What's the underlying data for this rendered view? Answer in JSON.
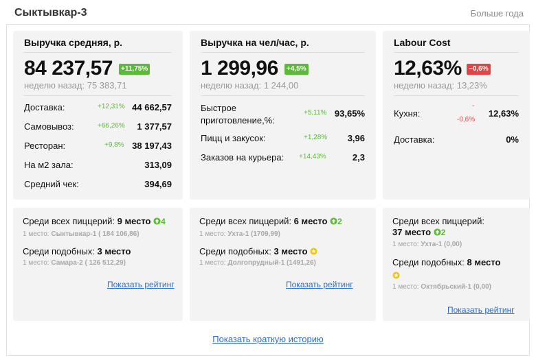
{
  "header": {
    "title": "Сыктывкар-3",
    "period": "Больше года"
  },
  "cards": [
    {
      "title": "Выручка средняя, р.",
      "value": "84 237,57",
      "delta": "+11,75%",
      "week_label": "неделю назад:",
      "week_value": "75 383,71",
      "rows": [
        {
          "label": "Доставка:",
          "pct": "+12,31%",
          "value": "44 662,57"
        },
        {
          "label": "Самовывоз:",
          "pct": "+66,26%",
          "value": "1 377,57"
        },
        {
          "label": "Ресторан:",
          "pct": "+9,8%",
          "value": "38 197,43"
        },
        {
          "label": "На м2 зала:",
          "pct": "",
          "value": "313,09"
        },
        {
          "label": "Средний чек:",
          "pct": "",
          "value": "394,69"
        }
      ]
    },
    {
      "title": "Выручка на чел/час, р.",
      "value": "1 299,96",
      "delta": "+4,5%",
      "week_label": "неделю назад:",
      "week_value": "1 244,00",
      "rows": [
        {
          "label_line1": "Быстрое",
          "label_line2": "приготовление,%:",
          "pct": "+5,11%",
          "value": "93,65%"
        },
        {
          "label": "Пицц и закусок:",
          "pct": "+1,28%",
          "value": "3,96"
        },
        {
          "label": "Заказов на курьера:",
          "pct": "+14,43%",
          "value": "2,3"
        }
      ]
    },
    {
      "title": "Labour Cost",
      "value": "12,63%",
      "delta": "−0,6%",
      "week_label": "неделю назад:",
      "week_value": "13,23%",
      "rows": [
        {
          "label": "Кухня:",
          "pct_dash": "-",
          "pct": "-0,6%",
          "value": "12,63%"
        },
        {
          "label": "Доставка:",
          "pct": "",
          "value": "0%"
        }
      ]
    }
  ],
  "ranking": [
    {
      "all_label": "Среди всех пиццерий:",
      "all_place": "9 место",
      "all_move": "4",
      "first_label": "1 место:",
      "all_first": "Сыктывкар-1 ( 184 106,86)",
      "similar_label": "Среди подобных:",
      "similar_place": "3 место",
      "similar_first": "Самара-2 ( 126 512,29)",
      "link": "Показать рейтинг"
    },
    {
      "all_label": "Среди всех пиццерий:",
      "all_place": "6 место",
      "all_move": "2",
      "first_label": "1 место:",
      "all_first": "Ухта-1 (1709,99)",
      "similar_label": "Среди подобных:",
      "similar_place": "3 место",
      "similar_first": "Долгопрудный-1 (1491,26)",
      "link": "Показать рейтинг"
    },
    {
      "all_label": "Среди всех пиццерий:",
      "all_place": "37 место",
      "all_move": "2",
      "first_label": "1 место:",
      "all_first": "Ухта-1 (0,00)",
      "similar_label": "Среди подобных:",
      "similar_place": "8 место",
      "similar_first": "Октябрьский-1 (0,00)",
      "link": "Показать рейтинг"
    }
  ],
  "footer": {
    "link": "Показать краткую историю"
  },
  "colors": {
    "green": "#5cb83a",
    "red": "#e14444",
    "link": "#2a6bc9",
    "card_bg": "#f3f3f3"
  },
  "icons": {
    "move_up": "up-arrow-circle-icon",
    "neutral": "star-circle-icon"
  }
}
